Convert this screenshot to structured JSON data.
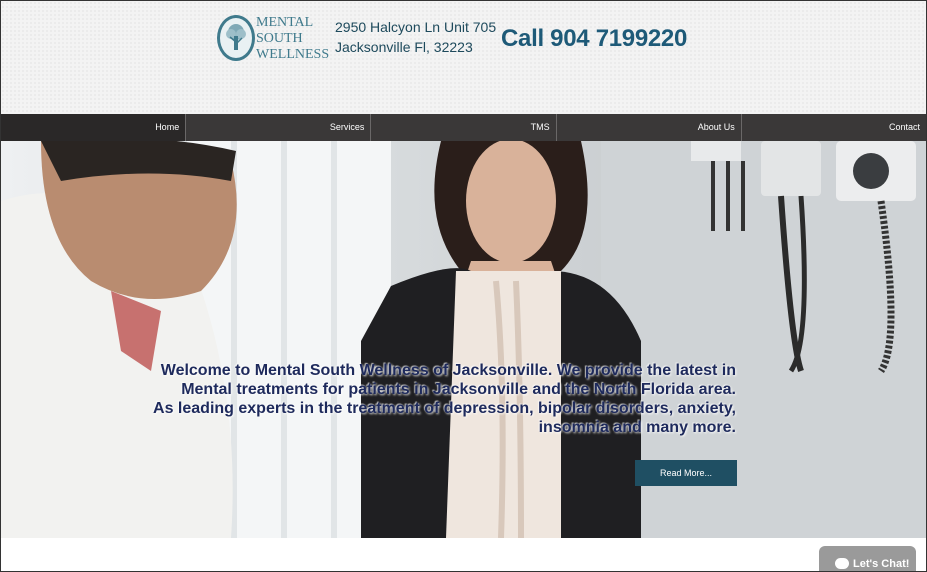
{
  "header": {
    "logo": {
      "line1": "MENTAL",
      "line2": "SOUTH",
      "line3": "WELLNESS"
    },
    "address": {
      "line1": "2950 Halcyon Ln Unit 705",
      "line2": "Jacksonville Fl, 32223"
    },
    "phone": "Call 904 7199220"
  },
  "nav": {
    "items": [
      {
        "label": "Home"
      },
      {
        "label": "Services"
      },
      {
        "label": "TMS"
      },
      {
        "label": "About Us"
      },
      {
        "label": "Contact"
      }
    ]
  },
  "hero": {
    "line1": "Welcome to Mental South Wellness of Jacksonville. We provide the latest in",
    "line2": "Mental treatments for patients in Jacksonville and the North Florida area.",
    "line3": "As leading experts in the treatment of depression, bipolar disorders, anxiety,",
    "line4": "insomnia and many more.",
    "button": "Read More..."
  },
  "chat": {
    "label": "Let's Chat!"
  },
  "colors": {
    "nav_bg": "#3a3838",
    "brand_teal": "#3f7a8c",
    "phone": "#1e5a78",
    "button": "#1f4f63"
  }
}
